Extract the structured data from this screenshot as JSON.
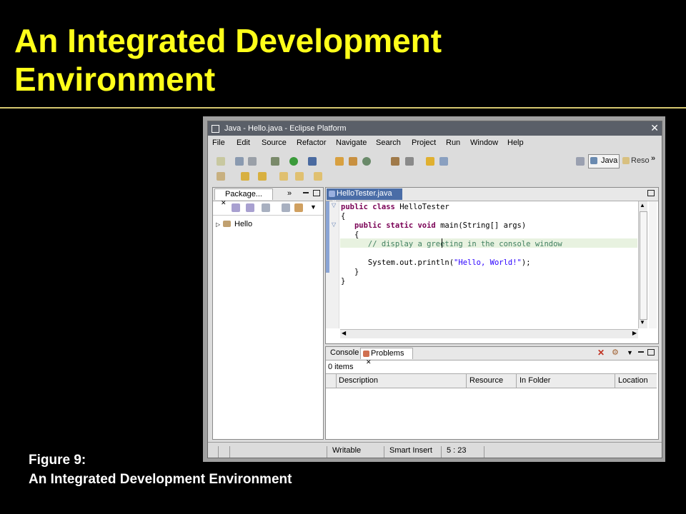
{
  "slide": {
    "title_line1": "An Integrated Development",
    "title_line2": "Environment",
    "caption_line1": "Figure 9:",
    "caption_line2": "An Integrated Development Environment"
  },
  "window": {
    "title": "Java - Hello.java - Eclipse Platform",
    "close_glyph": "✕"
  },
  "menu": [
    "File",
    "Edit",
    "Source",
    "Refactor",
    "Navigate",
    "Search",
    "Project",
    "Run",
    "Window",
    "Help"
  ],
  "perspectives": {
    "java": "Java",
    "resource": "Reso",
    "more": "»"
  },
  "package_explorer": {
    "tab_label": "Package...",
    "tab_close": "✕",
    "tree_item": "Hello"
  },
  "editor": {
    "tab_label": "HelloTester.java",
    "lines": [
      {
        "kw": "public class ",
        "rest": "HelloTester"
      },
      {
        "rest": "{"
      },
      {
        "kw": "   public static void ",
        "rest": "main(String[] args)"
      },
      {
        "rest": "   {"
      },
      {
        "cmt": "      // display a greeting in the console window"
      },
      {
        "rest": ""
      },
      {
        "rest": "      System.out.println(",
        "str": "\"Hello, World!\"",
        "tail": ");"
      },
      {
        "rest": "   }"
      },
      {
        "rest": "}"
      }
    ]
  },
  "bottom_panel": {
    "tab_console": "Console",
    "tab_problems": "Problems",
    "items_count": "0 items",
    "columns": [
      "Description",
      "Resource",
      "In Folder",
      "Location"
    ]
  },
  "statusbar": {
    "writable": "Writable",
    "insert_mode": "Smart Insert",
    "position": "5 : 23"
  },
  "colors": {
    "title": "#ffff1a",
    "keyword": "#7a0055",
    "comment": "#3f7f5f",
    "string": "#2a00ff",
    "current_line": "#e8f2e0"
  }
}
